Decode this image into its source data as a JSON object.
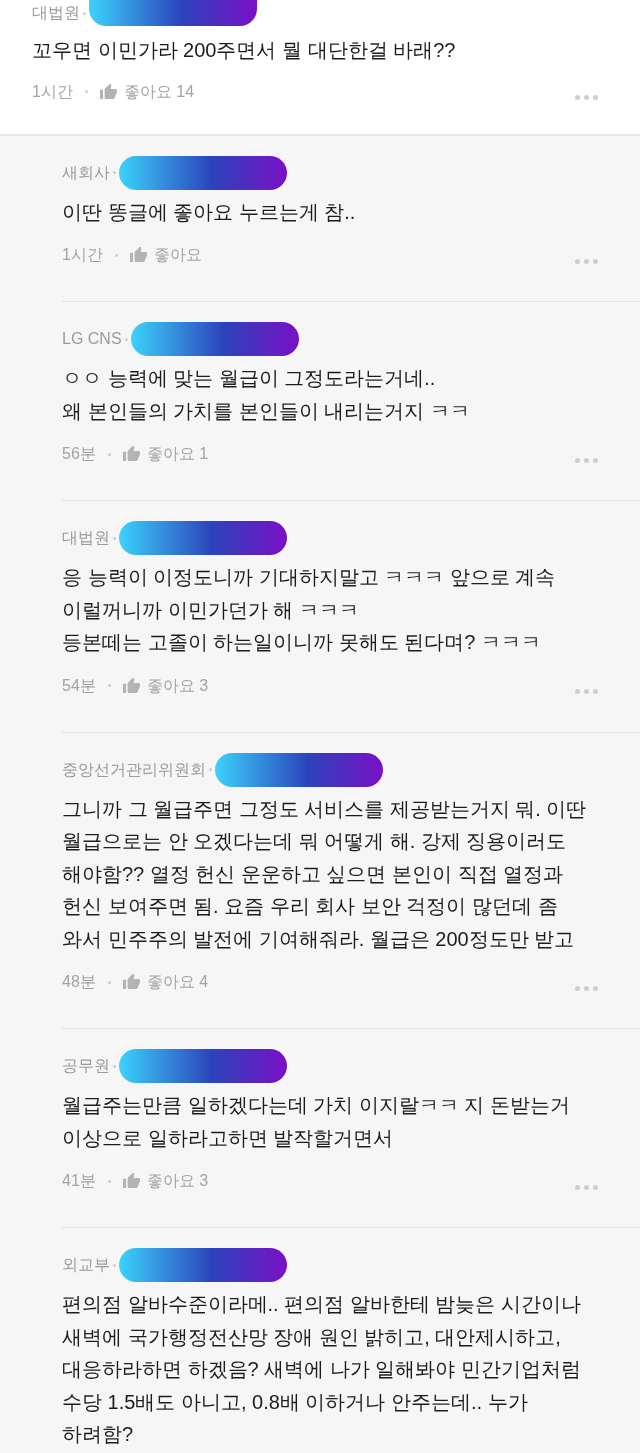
{
  "comment": {
    "author": "대법원",
    "lines": [
      "꼬우면 이민가라 200주면서 뭘 대단한걸 바래??"
    ],
    "time": "1시간",
    "like": "좋아요 14"
  },
  "replies": [
    {
      "author": "새회사",
      "lines": [
        "이딴 똥글에 좋아요 누르는게 참.."
      ],
      "time": "1시간",
      "like": "좋아요"
    },
    {
      "author": "LG CNS",
      "lines": [
        "ㅇㅇ 능력에 맞는 월급이 그정도라는거네..",
        "왜 본인들의 가치를 본인들이 내리는거지 ㅋㅋ"
      ],
      "time": "56분",
      "like": "좋아요 1"
    },
    {
      "author": "대법원",
      "lines": [
        "응 능력이 이정도니까 기대하지말고 ㅋㅋㅋ 앞으로 계속",
        "이럴꺼니까 이민가던가 해 ㅋㅋㅋ",
        "등본떼는 고졸이 하는일이니까 못해도 된다며? ㅋㅋㅋ"
      ],
      "time": "54분",
      "like": "좋아요 3"
    },
    {
      "author": "중앙선거관리위원회",
      "lines": [
        "그니까 그 월급주면 그정도 서비스를 제공받는거지 뭐. 이딴",
        "월급으로는 안 오겠다는데 뭐 어떻게 해. 강제 징용이러도",
        "해야함?? 열정 헌신 운운하고 싶으면 본인이 직접 열정과",
        "헌신 보여주면 됨. 요즘 우리 회사 보안 걱정이 많던데 좀",
        "와서 민주주의 발전에 기여해줘라. 월급은 200정도만 받고"
      ],
      "time": "48분",
      "like": "좋아요 4"
    },
    {
      "author": "공무원",
      "lines": [
        "월급주는만큼 일하겠다는데 가치 이지랄ㅋㅋ 지 돈받는거",
        "이상으로 일하라고하면 발작할거면서"
      ],
      "time": "41분",
      "like": "좋아요 3"
    },
    {
      "author": "외교부",
      "lines": [
        "편의점 알바수준이라메.. 편의점 알바한테 밤늦은 시간이나",
        "새벽에 국가행정전산망 장애 원인 밝히고, 대안제시하고,",
        "대응하라하면 하겠음? 새벽에 나가 일해봐야 민간기업처럼",
        "수당 1.5배도 아니고, 0.8배 이하거나 안주는데.. 누가",
        "하려함?"
      ]
    }
  ]
}
